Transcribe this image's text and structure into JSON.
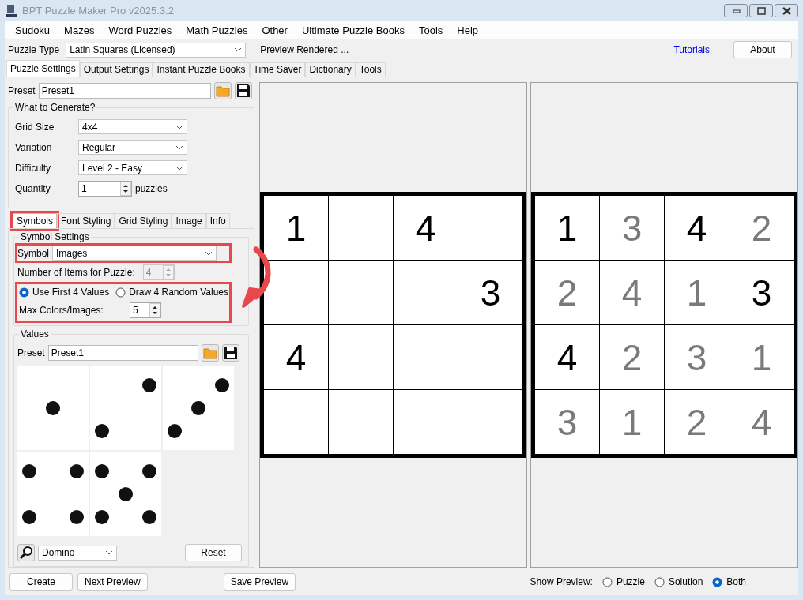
{
  "window": {
    "title": "BPT Puzzle Maker Pro v2025.3.2"
  },
  "menu": [
    "Sudoku",
    "Mazes",
    "Word Puzzles",
    "Math Puzzles",
    "Other",
    "Ultimate Puzzle Books",
    "Tools",
    "Help"
  ],
  "toolbar": {
    "puzzle_type_label": "Puzzle Type",
    "puzzle_type": "Latin Squares (Licensed)",
    "status": "Preview Rendered ...",
    "link": "Tutorials",
    "button": "About"
  },
  "tabs": [
    {
      "label": "Puzzle Settings",
      "selected": true
    },
    {
      "label": "Output Settings",
      "selected": false
    },
    {
      "label": "Instant Puzzle Books",
      "selected": false
    },
    {
      "label": "Time Saver",
      "selected": false
    },
    {
      "label": "Dictionary",
      "selected": false
    },
    {
      "label": "Tools",
      "selected": false
    }
  ],
  "preset": {
    "label": "Preset",
    "value": "Preset1"
  },
  "what_to_generate": {
    "title": "What to Generate?",
    "fields": [
      {
        "kind": "dropdown",
        "label": "Grid Size",
        "value": "4x4"
      },
      {
        "kind": "dropdown",
        "label": "Variation",
        "value": "Regular"
      },
      {
        "kind": "dropdown",
        "label": "Difficulty",
        "value": "Level 2 - Easy"
      },
      {
        "kind": "spinner",
        "label": "Quantity",
        "value": "1",
        "unit": "puzzles"
      }
    ]
  },
  "subtabs": [
    {
      "label": "Symbols",
      "selected": true,
      "highlighted": true
    },
    {
      "label": "Font Styling",
      "selected": false,
      "highlighted": false
    },
    {
      "label": "Grid Styling",
      "selected": false,
      "highlighted": false
    },
    {
      "label": "Image",
      "selected": false,
      "highlighted": false
    },
    {
      "label": "Info",
      "selected": false,
      "highlighted": false
    }
  ],
  "symbol_settings": {
    "title": "Symbol Settings",
    "symbol": {
      "label": "Symbol",
      "value": "Images",
      "highlighted": true
    },
    "items": {
      "label": "Number of Items for Puzzle:",
      "value": "4",
      "disabled": true
    },
    "options_highlighted": true,
    "radios": [
      {
        "label": "Use First 4 Values",
        "selected": true
      },
      {
        "label": "Draw 4 Random Values",
        "selected": false
      }
    ],
    "max": {
      "label": "Max Colors/Images:",
      "value": "5"
    }
  },
  "values": {
    "title": "Values",
    "preset": {
      "label": "Preset",
      "value": "Preset1"
    },
    "images": [
      {
        "kind": "one"
      },
      {
        "kind": "two"
      },
      {
        "kind": "three"
      },
      {
        "kind": "four"
      },
      {
        "kind": "five"
      }
    ],
    "set": "Domino",
    "reset": "Reset"
  },
  "puzzle": [
    [
      {
        "kind": "given",
        "text": "1"
      },
      {
        "kind": "blank"
      },
      {
        "kind": "given",
        "text": "4"
      },
      {
        "kind": "blank"
      }
    ],
    [
      {
        "kind": "blank"
      },
      {
        "kind": "blank"
      },
      {
        "kind": "blank"
      },
      {
        "kind": "given",
        "text": "3"
      }
    ],
    [
      {
        "kind": "given",
        "text": "4"
      },
      {
        "kind": "blank"
      },
      {
        "kind": "blank"
      },
      {
        "kind": "blank"
      }
    ],
    [
      {
        "kind": "blank"
      },
      {
        "kind": "blank"
      },
      {
        "kind": "blank"
      },
      {
        "kind": "blank"
      }
    ]
  ],
  "solution": [
    [
      {
        "text": "1",
        "given": true
      },
      {
        "text": "3",
        "given": false
      },
      {
        "text": "4",
        "given": true
      },
      {
        "text": "2",
        "given": false
      }
    ],
    [
      {
        "text": "2",
        "given": false
      },
      {
        "text": "4",
        "given": false
      },
      {
        "text": "1",
        "given": false
      },
      {
        "text": "3",
        "given": true
      }
    ],
    [
      {
        "text": "4",
        "given": true
      },
      {
        "text": "2",
        "given": false
      },
      {
        "text": "3",
        "given": false
      },
      {
        "text": "1",
        "given": false
      }
    ],
    [
      {
        "text": "3",
        "given": false
      },
      {
        "text": "1",
        "given": false
      },
      {
        "text": "2",
        "given": false
      },
      {
        "text": "4",
        "given": false
      }
    ]
  ],
  "bottom": {
    "buttons": [
      "Create",
      "Next Preview",
      "Save Preview"
    ],
    "show_label": "Show Preview:",
    "options": [
      {
        "label": "Puzzle",
        "selected": false
      },
      {
        "label": "Solution",
        "selected": false
      },
      {
        "label": "Both",
        "selected": true
      }
    ]
  }
}
